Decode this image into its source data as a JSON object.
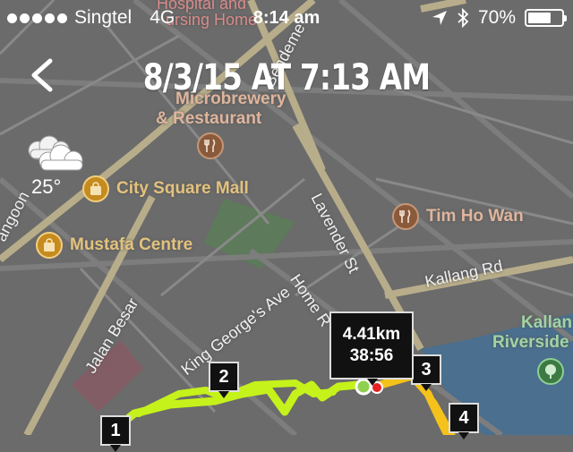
{
  "status_bar": {
    "carrier": "Singtel",
    "network": "4G",
    "time": "8:14 am",
    "battery": "70%",
    "battery_level": 0.7,
    "icons": [
      "signal-dots-icon",
      "location-arrow-icon",
      "bluetooth-icon",
      "battery-icon"
    ]
  },
  "header": {
    "title": "8/3/15 AT 7:13 AM",
    "back_icon": "chevron-left-icon"
  },
  "weather": {
    "temperature": "25°",
    "icon": "cloud-icon"
  },
  "map": {
    "pois": [
      {
        "name": "Microbrewery & Restaurant",
        "line1": "Microbrewery",
        "line2": "& Restaurant",
        "icon": "fork-knife-icon",
        "category": "food"
      },
      {
        "name": "City Square Mall",
        "icon": "shopping-bag-icon",
        "category": "shopping"
      },
      {
        "name": "Tim Ho Wan",
        "icon": "fork-knife-icon",
        "category": "food"
      },
      {
        "name": "Mustafa Centre",
        "icon": "shopping-bag-icon",
        "category": "shopping"
      },
      {
        "name": "Kallang Riverside",
        "line1": "Kallan",
        "line2": "Riverside",
        "icon": "tree-icon",
        "category": "park"
      }
    ],
    "top_labels": {
      "hospital": "Hospital and",
      "homes": "ursing Home"
    },
    "streets": {
      "bendemeer": "Bendeme",
      "lavender": "Lavender St",
      "kallang": "Kallang Rd",
      "king_george": "King George's Ave",
      "home": "Home R",
      "jalan_besar": "Jalan Besar",
      "rangoon": "angoon"
    },
    "colors": {
      "background": "#6b6b6b",
      "road": "#8a8a8a",
      "major_road": "#b8ad8a",
      "park": "#5d7a5a",
      "water": "#4a6f8f",
      "route": "#c5f21b",
      "route_alt": "#f5c21b"
    }
  },
  "run": {
    "distance": "4.41km",
    "duration": "38:56",
    "split_markers": [
      "1",
      "2",
      "3",
      "4"
    ]
  }
}
